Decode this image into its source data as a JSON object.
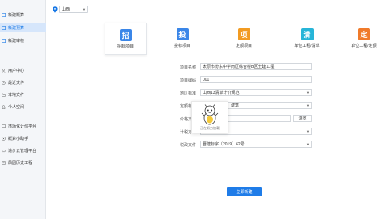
{
  "sidebar": {
    "items": [
      {
        "label": "新建概算",
        "icon": "doc-icon"
      },
      {
        "label": "新建预算",
        "icon": "doc-icon",
        "active": true
      },
      {
        "label": "新建审核",
        "icon": "doc-icon"
      },
      {
        "label": "用户中心",
        "icon": "user-icon"
      },
      {
        "label": "最近文件",
        "icon": "clock-icon"
      },
      {
        "label": "本地文件",
        "icon": "folder-icon"
      },
      {
        "label": "个人空间",
        "icon": "person-icon"
      },
      {
        "label": "市场化计价平台",
        "icon": "monitor-icon"
      },
      {
        "label": "概算小助手",
        "icon": "helper-icon"
      },
      {
        "label": "造价云管理平台",
        "icon": "cloud-icon"
      },
      {
        "label": "局园历史工程",
        "icon": "history-icon"
      }
    ]
  },
  "topbar": {
    "location": "山西",
    "location_icon": "location-pin-icon"
  },
  "tabs": [
    {
      "label": "招标项目",
      "glyph": "招",
      "color": "#3a86e8",
      "active": true
    },
    {
      "label": "投标项目",
      "glyph": "投",
      "color": "#3a86e8"
    },
    {
      "label": "定额项目",
      "glyph": "项",
      "color": "#f29b22"
    },
    {
      "label": "单位工程/清单",
      "glyph": "清",
      "color": "#27b5d8"
    },
    {
      "label": "单位工程/定额",
      "glyph": "定",
      "color": "#f07a2a"
    }
  ],
  "form": {
    "project_name_label": "项目名称",
    "project_name_value": "太原市汾东中学南区综合楼B区土建工程",
    "project_code_label": "项目编码",
    "project_code_value": "001",
    "region_label": "地区标准",
    "region_value": "山西13清单计价规范",
    "quota_label": "定额标",
    "quota_value": "建筑",
    "price_label": "价格文",
    "price_value": "",
    "browse_label": "浏览",
    "tax_label": "计税方",
    "tax_value": "",
    "policy_label": "税改文件",
    "policy_value": "晋建标字〔2019〕62号"
  },
  "overlay": {
    "text": "正在努力加载"
  },
  "submit_label": "立即新建"
}
